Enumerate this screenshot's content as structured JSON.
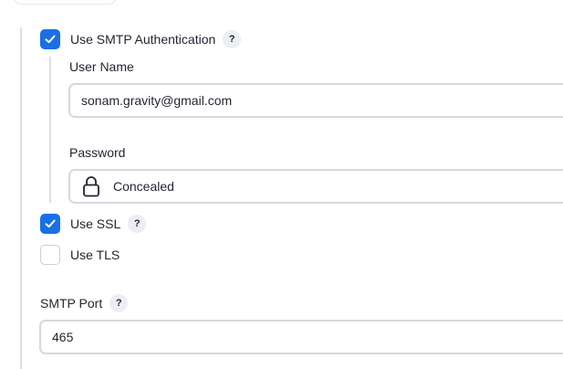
{
  "smtp_auth": {
    "checked": true,
    "label": "Use SMTP Authentication",
    "help": "?",
    "username_label": "User Name",
    "username_value": "sonam.gravity@gmail.com",
    "password_label": "Password",
    "password_value": "Concealed"
  },
  "ssl": {
    "checked": true,
    "label": "Use SSL",
    "help": "?"
  },
  "tls": {
    "checked": false,
    "label": "Use TLS"
  },
  "port": {
    "label": "SMTP Port",
    "help": "?",
    "value": "465"
  },
  "colors": {
    "accent": "#1a6fe6",
    "border": "#d5d9e0",
    "help_bg": "#eceef2"
  },
  "icons": {
    "check": "check-icon",
    "lock": "lock-icon",
    "help": "help-icon"
  }
}
